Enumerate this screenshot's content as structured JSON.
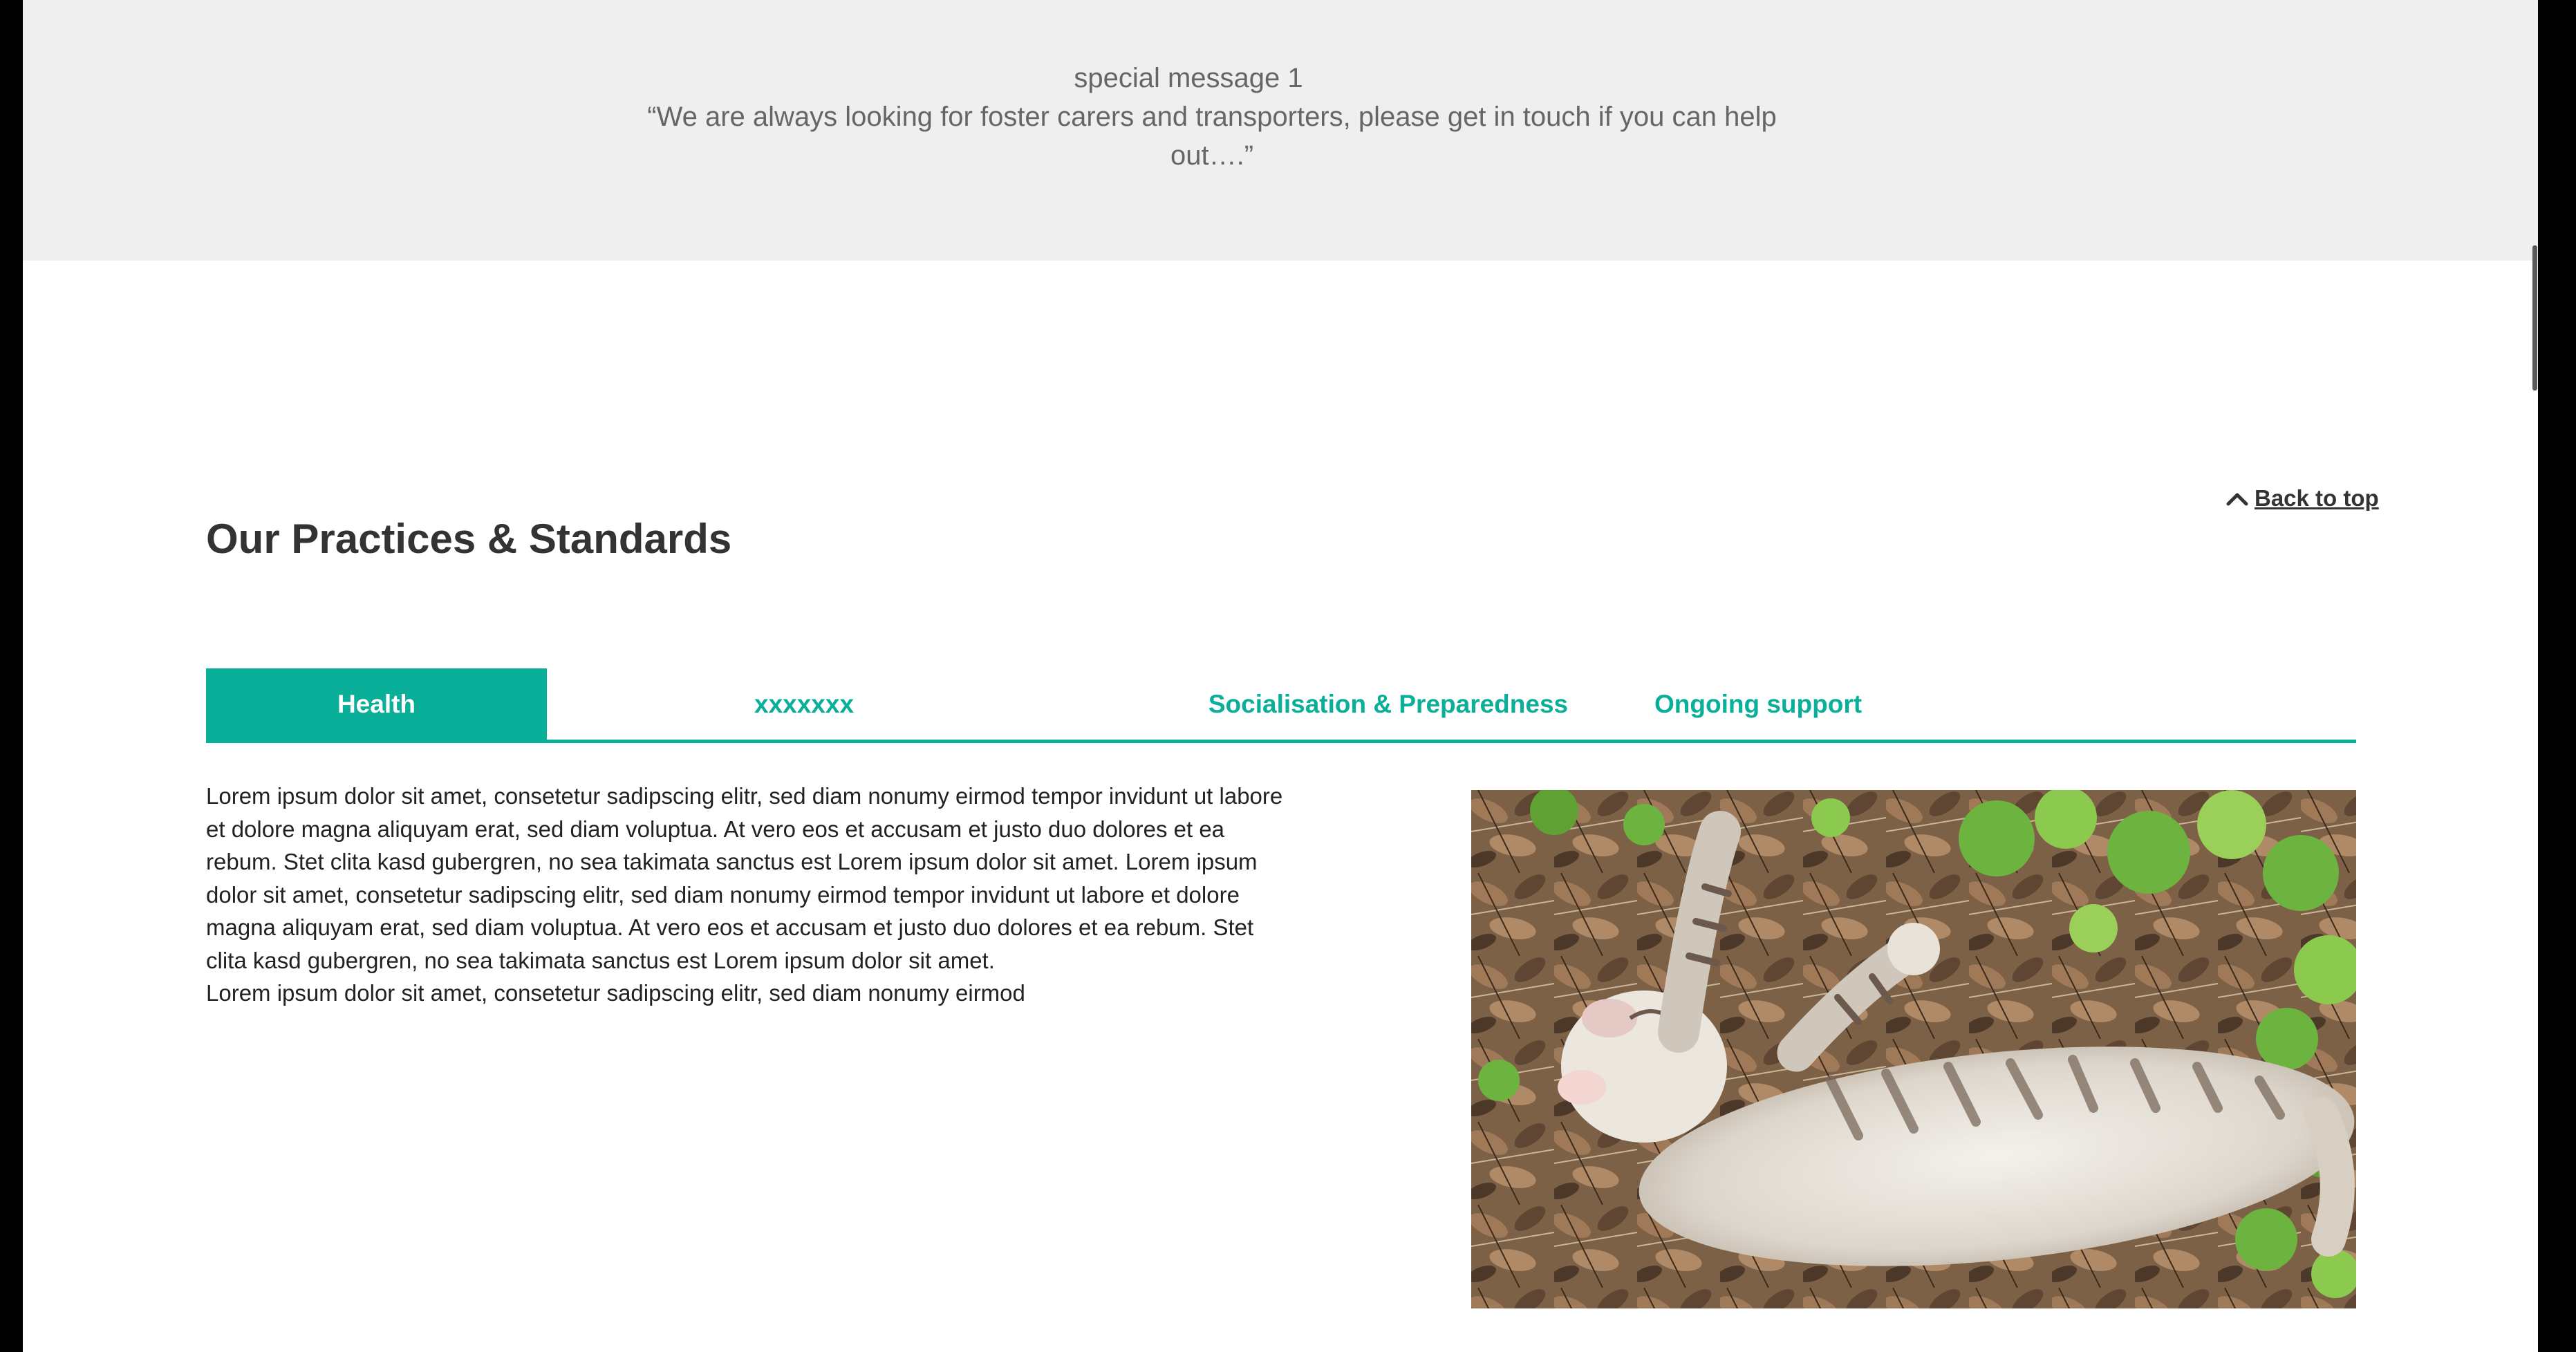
{
  "message": {
    "title": "special message 1",
    "quote": "“We are always looking for foster carers and transporters, please get in touch if you can help out….”"
  },
  "section": {
    "title": "Our Practices & Standards",
    "back_to_top": "Back to top"
  },
  "tabs": [
    {
      "label": "Health",
      "active": true
    },
    {
      "label": "xxxxxxx",
      "active": false
    },
    {
      "label": "Socialisation & Preparedness",
      "active": false
    },
    {
      "label": "Ongoing support",
      "active": false
    }
  ],
  "content": {
    "paragraph1": "Lorem ipsum dolor sit amet, consetetur sadipscing elitr, sed diam nonumy eirmod tempor invidunt ut labore et dolore magna aliquyam erat, sed diam voluptua. At vero eos et accusam et justo duo dolores et ea rebum. Stet clita kasd gubergren, no sea takimata sanctus est Lorem ipsum dolor sit amet. Lorem ipsum dolor sit amet, consetetur sadipscing elitr, sed diam nonumy eirmod tempor invidunt ut labore et dolore magna aliquyam erat, sed diam voluptua. At vero eos et accusam et justo duo dolores et ea rebum. Stet clita kasd gubergren, no sea takimata sanctus est Lorem ipsum dolor sit amet.",
    "paragraph2": "Lorem ipsum dolor sit amet, consetetur sadipscing elitr, sed diam nonumy eirmod"
  },
  "colors": {
    "accent": "#0aaf9a",
    "band": "#efefef",
    "heading": "#333333"
  },
  "icons": {
    "back_to_top": "chevron-up-icon"
  }
}
